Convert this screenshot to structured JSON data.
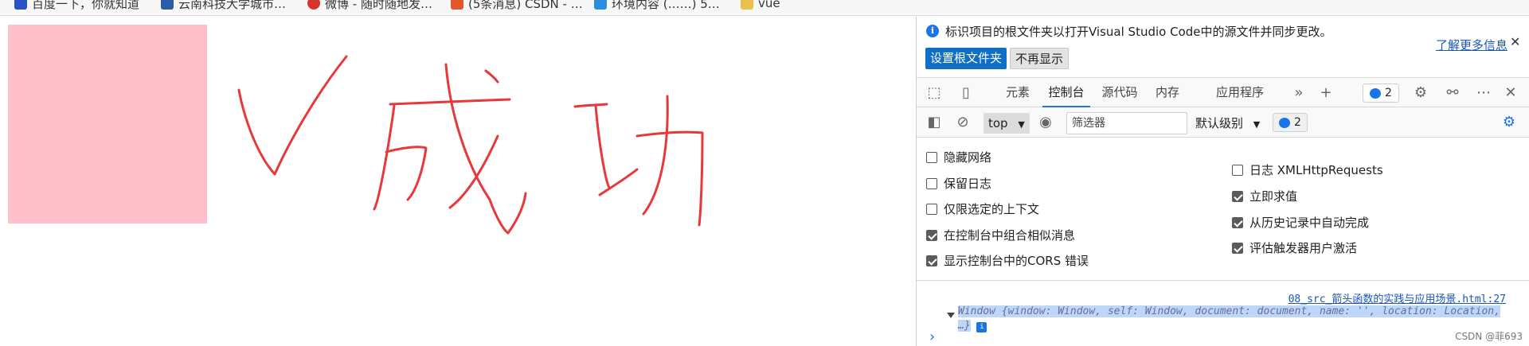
{
  "bookmarks": [
    {
      "label": "百度一下，你就知道",
      "icon": "paw-icon",
      "color": "#2953c4"
    },
    {
      "label": "云南科技大学城市…",
      "icon": "gem-icon",
      "color": "#2a5fa8"
    },
    {
      "label": "微博 - 随时随地发…",
      "icon": "weibo-icon",
      "color": "#d8332a"
    },
    {
      "label": "(5条消息) CSDN - …",
      "icon": "csdn-icon",
      "color": "#e4562c"
    },
    {
      "label": "环境内容 (……) 5…",
      "icon": "box-icon",
      "color": "#2b8de0"
    },
    {
      "label": "vue",
      "icon": "folder-icon",
      "color": "#e8c04a"
    }
  ],
  "canvas": {
    "drawn_text": "V成功",
    "box_color": "#ffc0cb",
    "stroke_color": "#e8383a"
  },
  "devtools": {
    "infobar": {
      "message": "标识项目的根文件夹以打开Visual Studio Code中的源文件并同步更改。",
      "set_root_button": "设置根文件夹",
      "dont_show_button": "不再显示",
      "learn_more": "了解更多信息",
      "close": "✕"
    },
    "tabs": [
      {
        "label": "元素",
        "active": false
      },
      {
        "label": "控制台",
        "active": true
      },
      {
        "label": "源代码",
        "active": false
      },
      {
        "label": "内存",
        "active": false
      },
      {
        "label": "应用程序",
        "active": false
      }
    ],
    "issues_count": "2",
    "console_toolbar": {
      "context": "top",
      "filter_placeholder": "筛选器",
      "levels": "默认级别",
      "issues_count": "2"
    },
    "settings_left": [
      {
        "label": "隐藏网络",
        "checked": false
      },
      {
        "label": "保留日志",
        "checked": false
      },
      {
        "label": "仅限选定的上下文",
        "checked": false
      },
      {
        "label": "在控制台中组合相似消息",
        "checked": true
      },
      {
        "label": "显示控制台中的CORS 错误",
        "checked": true
      }
    ],
    "settings_right": [
      {
        "label": "日志 XMLHttpRequests",
        "checked": false
      },
      {
        "label": "立即求值",
        "checked": true
      },
      {
        "label": "从历史记录中自动完成",
        "checked": true
      },
      {
        "label": "评估触发器用户激活",
        "checked": true
      }
    ],
    "console": {
      "source_link": "08_src_箭头函数的实践与应用场景.html:27",
      "log_text": "Window {window: Window, self: Window, document: document, name: '', location: Location, …}",
      "info_badge": "i",
      "prompt": "›"
    }
  },
  "watermark": "CSDN @菲693"
}
